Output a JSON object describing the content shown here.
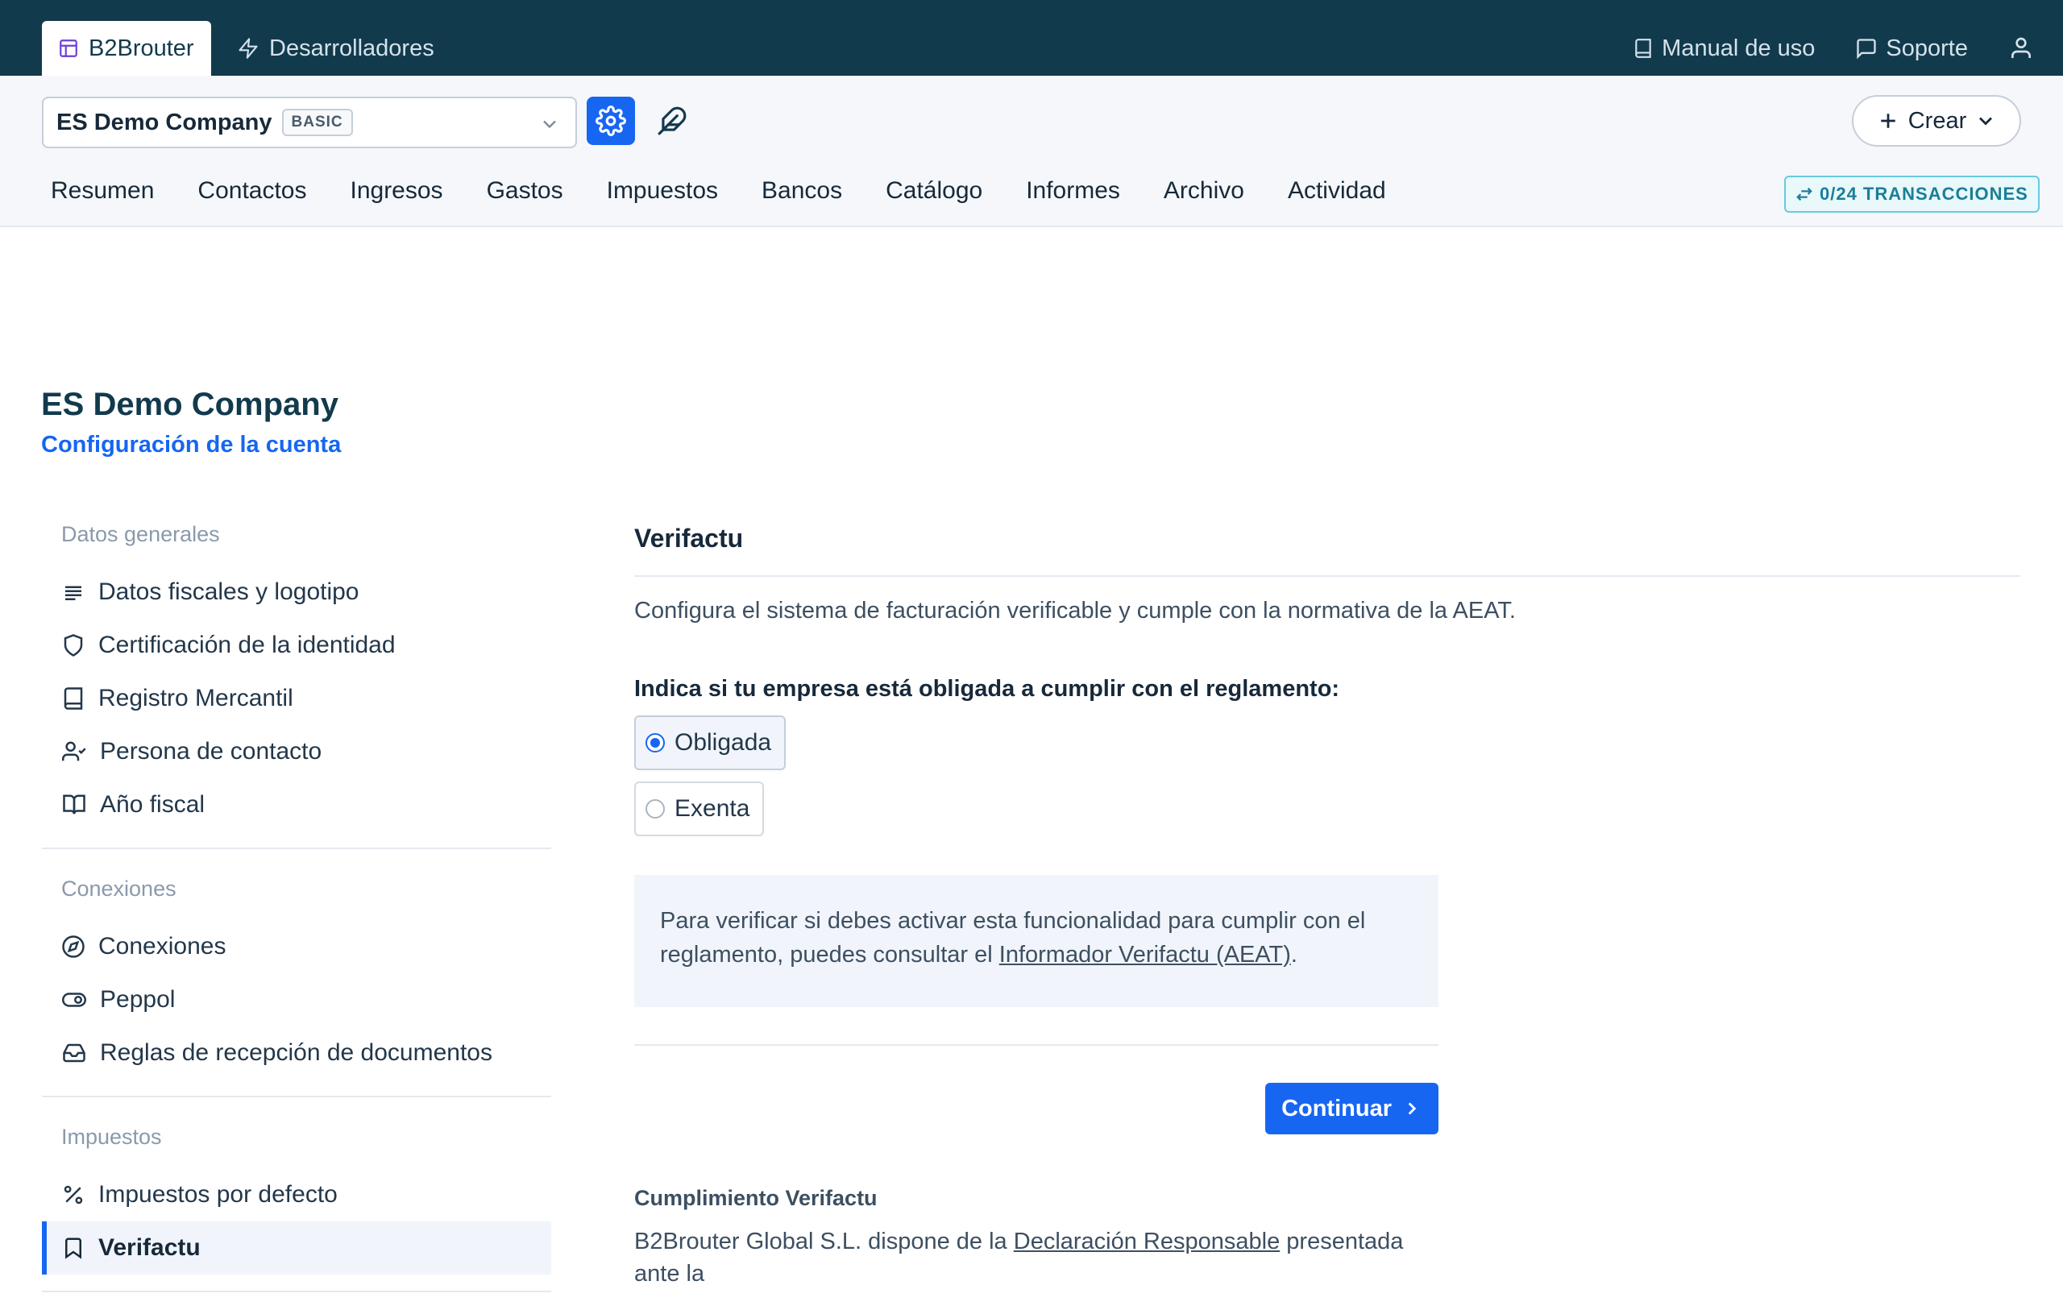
{
  "topbar": {
    "app_tab": "B2Brouter",
    "dev_tab": "Desarrolladores",
    "manual_link": "Manual de uso",
    "support_link": "Soporte"
  },
  "company_bar": {
    "company_name": "ES Demo Company",
    "plan_badge": "BASIC",
    "create_button": "Crear",
    "transactions_badge": "0/24 TRANSACCIONES"
  },
  "main_nav": [
    "Resumen",
    "Contactos",
    "Ingresos",
    "Gastos",
    "Impuestos",
    "Bancos",
    "Catálogo",
    "Informes",
    "Archivo",
    "Actividad"
  ],
  "page": {
    "title": "ES Demo Company",
    "subtitle": "Configuración de la cuenta"
  },
  "sidebar": {
    "groups": [
      {
        "title": "Datos generales",
        "items": [
          {
            "label": "Datos fiscales y logotipo",
            "icon": "align-left-icon"
          },
          {
            "label": "Certificación de la identidad",
            "icon": "shield-icon"
          },
          {
            "label": "Registro Mercantil",
            "icon": "book-icon"
          },
          {
            "label": "Persona de contacto",
            "icon": "user-check-icon"
          },
          {
            "label": "Año fiscal",
            "icon": "book-open-icon"
          }
        ]
      },
      {
        "title": "Conexiones",
        "items": [
          {
            "label": "Conexiones",
            "icon": "compass-icon"
          },
          {
            "label": "Peppol",
            "icon": "toggle-icon"
          },
          {
            "label": "Reglas de recepción de documentos",
            "icon": "inbox-icon"
          }
        ]
      },
      {
        "title": "Impuestos",
        "items": [
          {
            "label": "Impuestos por defecto",
            "icon": "percent-icon"
          },
          {
            "label": "Verifactu",
            "icon": "bookmark-icon",
            "active": true
          }
        ]
      }
    ]
  },
  "content": {
    "section_title": "Verifactu",
    "description": "Configura el sistema de facturación verificable y cumple con la normativa de la AEAT.",
    "question": "Indica si tu empresa está obligada a cumplir con el reglamento:",
    "options": [
      {
        "label": "Obligada",
        "selected": true
      },
      {
        "label": "Exenta",
        "selected": false
      }
    ],
    "info_prefix": "Para verificar si debes activar esta funcionalidad para cumplir con el reglamento, puedes consultar el ",
    "info_link": "Informador Verifactu (AEAT)",
    "info_suffix": ".",
    "continue_button": "Continuar",
    "compliance_title": "Cumplimiento Verifactu",
    "compliance_prefix": "B2Brouter Global S.L. dispone de la ",
    "compliance_link": "Declaración Responsable",
    "compliance_suffix": " presentada ante la"
  },
  "colors": {
    "topbar_bg": "#123a4d",
    "accent": "#1766f2",
    "subbar_bg": "#f5f7fa",
    "badge_teal": "#1a7e99"
  }
}
